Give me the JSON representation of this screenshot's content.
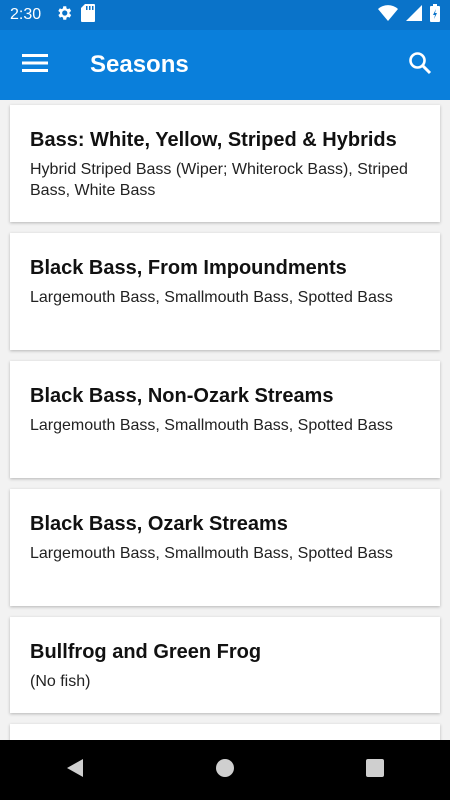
{
  "status_bar": {
    "time": "2:30",
    "icons": [
      "gear-icon",
      "sd-card-icon",
      "wifi-icon",
      "signal-icon",
      "battery-icon"
    ]
  },
  "app_bar": {
    "title": "Seasons",
    "menu_icon": "hamburger-menu-icon",
    "search_icon": "search-icon",
    "color": "#0a7fdb"
  },
  "seasons": [
    {
      "title": "Bass: White, Yellow, Striped & Hybrids",
      "subtitle": "Hybrid Striped Bass (Wiper; Whiterock Bass), Striped Bass, White Bass"
    },
    {
      "title": "Black Bass, From Impoundments",
      "subtitle": "Largemouth Bass, Smallmouth Bass, Spotted Bass"
    },
    {
      "title": "Black Bass, Non-Ozark Streams",
      "subtitle": "Largemouth Bass, Smallmouth Bass, Spotted Bass"
    },
    {
      "title": "Black Bass, Ozark Streams",
      "subtitle": "Largemouth Bass, Smallmouth Bass, Spotted Bass"
    },
    {
      "title": "Bullfrog and Green Frog",
      "subtitle": "(No fish)"
    }
  ],
  "nav_bar": {
    "icons": [
      "back-icon",
      "home-icon",
      "recents-icon"
    ]
  }
}
